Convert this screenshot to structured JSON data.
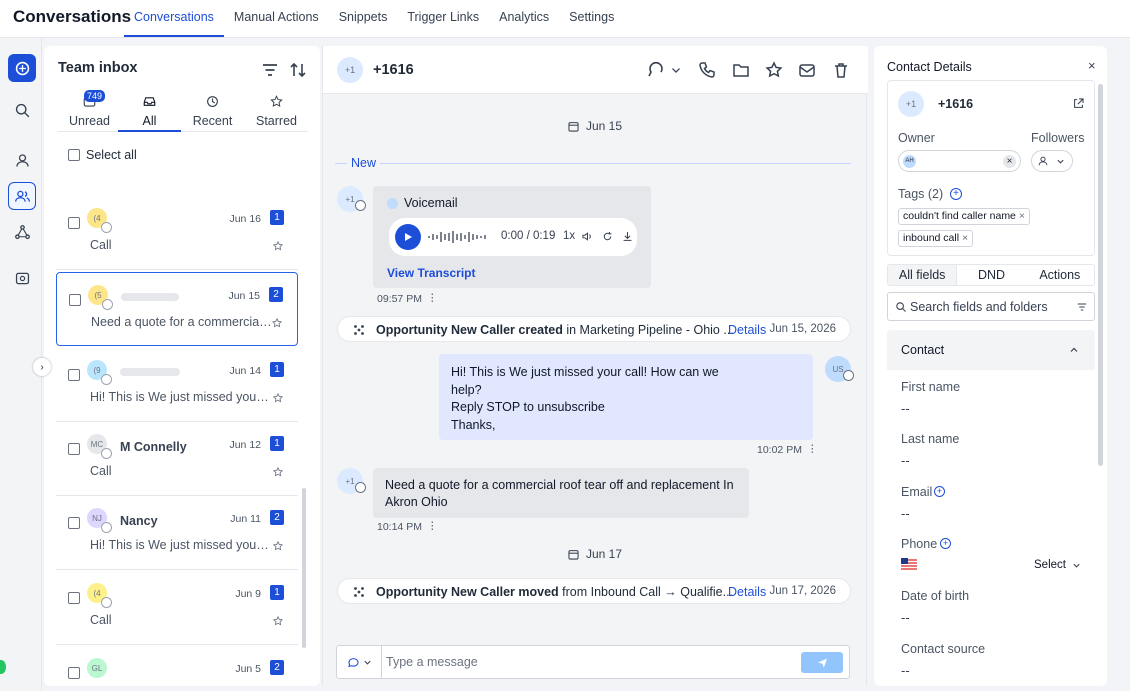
{
  "app": {
    "title": "Conversations"
  },
  "nav": {
    "tabs": [
      "Conversations",
      "Manual Actions",
      "Snippets",
      "Trigger Links",
      "Analytics",
      "Settings"
    ]
  },
  "inbox": {
    "title": "Team inbox",
    "filter_tabs": [
      {
        "label": "Unread",
        "icon": "inbox-unread-icon",
        "badge": "749"
      },
      {
        "label": "All",
        "icon": "inbox-icon"
      },
      {
        "label": "Recent",
        "icon": "clock-icon"
      },
      {
        "label": "Starred",
        "icon": "star-icon"
      }
    ],
    "select_all": "Select all",
    "conversations": [
      {
        "avatar": "(4",
        "name": "",
        "date": "Jun 16",
        "count": "1",
        "preview": "Call",
        "channel": "phone"
      },
      {
        "avatar": "(5",
        "name": "",
        "date": "Jun 15",
        "count": "2",
        "preview": "Need a quote for a commercial roof tear off and replacement In Akron Ohio",
        "channel": "sms",
        "selected": true
      },
      {
        "avatar": "(9",
        "name": "",
        "date": "Jun 14",
        "count": "1",
        "preview": "Hi! This is                   We just missed your call!",
        "channel": "sms"
      },
      {
        "avatar": "MC",
        "name": "M Connelly",
        "date": "Jun 12",
        "count": "1",
        "preview": "Call",
        "channel": "phone"
      },
      {
        "avatar": "NJ",
        "name": "Nancy",
        "date": "Jun 11",
        "count": "2",
        "preview": "Hi! This is                   We just missed your call!",
        "channel": "sms"
      },
      {
        "avatar": "(4",
        "name": "",
        "date": "Jun 9",
        "count": "1",
        "preview": "Call",
        "channel": "phone"
      },
      {
        "avatar": "GL",
        "name": "",
        "date": "Jun 5",
        "count": "2",
        "preview": "",
        "channel": "sms"
      }
    ]
  },
  "chat": {
    "header_avatar": "+1",
    "header_number": "+1616",
    "date1": "Jun 15",
    "new_label": "New",
    "voicemail": {
      "avatar": "+1",
      "title": "Voicemail",
      "time": "0:00 / 0:19",
      "speed": "1x",
      "transcript_link": "View Transcript",
      "stamp": "09:57 PM"
    },
    "activity1": {
      "bold": "Opportunity New Caller created",
      "rest": " in Marketing Pipeline - Ohio ...",
      "link": "Details",
      "date": "Jun 15, 2026"
    },
    "outbound": {
      "avatar": "US",
      "line1": "Hi! This is                      We just missed your call! How can we",
      "line2": "help?",
      "line3": "Reply STOP to unsubscribe",
      "line4": "Thanks,",
      "stamp": "10:02 PM"
    },
    "inbound": {
      "avatar": "+1",
      "line1": "Need a quote for a commercial roof tear off and replacement In",
      "line2": "Akron Ohio",
      "stamp": "10:14 PM"
    },
    "date2": "Jun 17",
    "activity2": {
      "bold": "Opportunity New Caller moved",
      "rest": " from Inbound Call → Qualifie...",
      "link": "Details",
      "date": "Jun 17, 2026"
    },
    "composer_placeholder": "Type a message"
  },
  "contact": {
    "panel_title": "Contact Details",
    "close": "×",
    "avatar": "+1",
    "number": "+1616",
    "owner_label": "Owner",
    "owner_initials": "AH",
    "followers_label": "Followers",
    "tags_label": "Tags (2)",
    "tags": [
      "couldn't find caller name",
      "inbound call"
    ],
    "tabs": [
      "All fields",
      "DND",
      "Actions"
    ],
    "search_placeholder": "Search fields and folders",
    "section": "Contact",
    "fields": [
      {
        "label": "First name",
        "value": "--"
      },
      {
        "label": "Last name",
        "value": "--"
      },
      {
        "label": "Email",
        "value": "--"
      },
      {
        "label": "Phone",
        "value": ""
      },
      {
        "label": "Date of birth",
        "value": "--"
      },
      {
        "label": "Contact source",
        "value": "--"
      }
    ],
    "phone_select": "Select",
    "accent": "#1d4ed8"
  }
}
